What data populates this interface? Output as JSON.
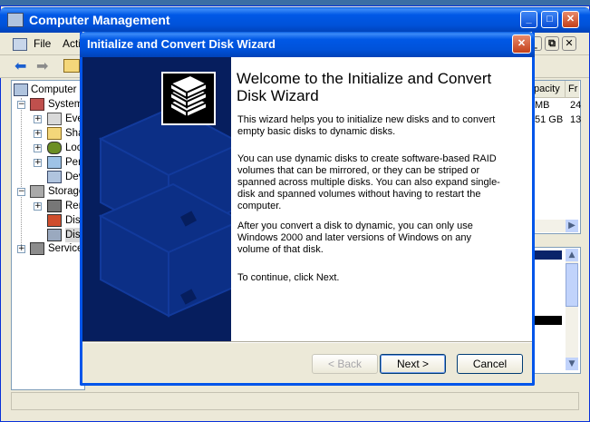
{
  "main_window": {
    "title": "Computer Management",
    "menu": [
      "File",
      "Acti"
    ],
    "tree": [
      {
        "label": "Computer N"
      },
      {
        "label": "System"
      },
      {
        "label": "Eve"
      },
      {
        "label": "Sha"
      },
      {
        "label": "Loc"
      },
      {
        "label": "Per"
      },
      {
        "label": "Dev"
      },
      {
        "label": "Storage"
      },
      {
        "label": "Rer"
      },
      {
        "label": "Disk"
      },
      {
        "label": "Disk"
      },
      {
        "label": "Service"
      }
    ],
    "columns": [
      "pacity",
      "Fr"
    ],
    "rows": [
      [
        "MB",
        "24"
      ],
      [
        "51 GB",
        "13"
      ]
    ]
  },
  "wizard": {
    "title": "Initialize and Convert Disk Wizard",
    "heading": "Welcome to the Initialize and Convert Disk Wizard",
    "paragraphs": [
      "This wizard helps you to initialize new disks and to convert empty basic disks to dynamic disks.",
      "You can use dynamic disks to create software-based RAID volumes that can be mirrored, or they can be striped or spanned across multiple disks. You can also expand single-disk and spanned volumes without having to restart the computer.",
      "After you convert a disk to dynamic, you can only use Windows 2000 and later versions of Windows on any volume of that disk.",
      "To continue, click Next."
    ],
    "buttons": {
      "back": "< Back",
      "next": "Next >",
      "cancel": "Cancel"
    }
  },
  "colors": {
    "title_blue": "#0054e3",
    "wizard_panel": "#061e5e",
    "dialog_face": "#ece9d8"
  }
}
